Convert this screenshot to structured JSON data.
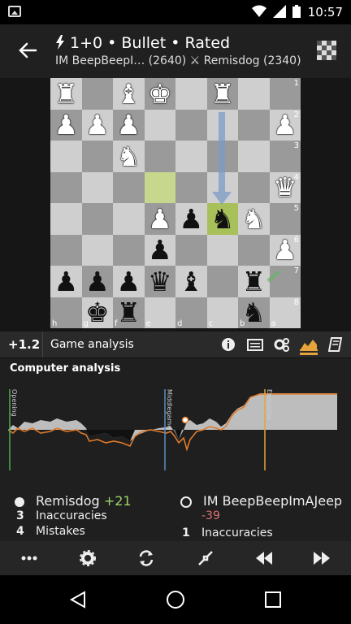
{
  "status": {
    "time": "10:57"
  },
  "header": {
    "title": "1+0 • Bullet • Rated",
    "subtitle": "IM BeepBeepI… (2640) ⚔ Remisdog (2340)"
  },
  "board": {
    "ranks": [
      "1",
      "2",
      "3",
      "4",
      "5",
      "6",
      "7",
      "8"
    ],
    "files": [
      "h",
      "g",
      "f",
      "e",
      "d",
      "c",
      "b",
      "a"
    ],
    "squares": [
      [
        "wR",
        "",
        "wB",
        "wK",
        "",
        "wR",
        "",
        ""
      ],
      [
        "wP",
        "wP",
        "wP",
        "",
        "",
        "",
        "",
        "wP"
      ],
      [
        "",
        "",
        "wN",
        "",
        "",
        "",
        "",
        ""
      ],
      [
        "",
        "",
        "",
        "",
        "",
        "",
        "",
        "wQ"
      ],
      [
        "",
        "",
        "",
        "wP",
        "bP",
        "bN",
        "wN",
        ""
      ],
      [
        "",
        "",
        "",
        "bP",
        "",
        "",
        "",
        "wP"
      ],
      [
        "bP",
        "bP",
        "bP",
        "bQ",
        "bB",
        "",
        "bR",
        ""
      ],
      [
        "",
        "bK",
        "bR",
        "",
        "",
        "",
        "bN",
        ""
      ]
    ]
  },
  "analysis_bar": {
    "eval": "+1.2",
    "label": "Game analysis"
  },
  "analysis": {
    "title": "Computer analysis",
    "phases": [
      "Opening",
      "Middlegame",
      "Endgame"
    ],
    "white": {
      "name": "Remisdog",
      "acpl": "+21",
      "inaccuracies": "3",
      "inaccuracies_label": "Inaccuracies",
      "mistakes": "4",
      "mistakes_label": "Mistakes"
    },
    "black": {
      "name": "IM BeepBeepImAJeep",
      "acpl": "-39",
      "inaccuracies": "1",
      "inaccuracies_label": "Inaccuracies"
    }
  },
  "colors": {
    "accent": "#e6a43a",
    "highlight": "#a8c05a",
    "negative": "#e07070",
    "positive": "#9bd46a"
  }
}
